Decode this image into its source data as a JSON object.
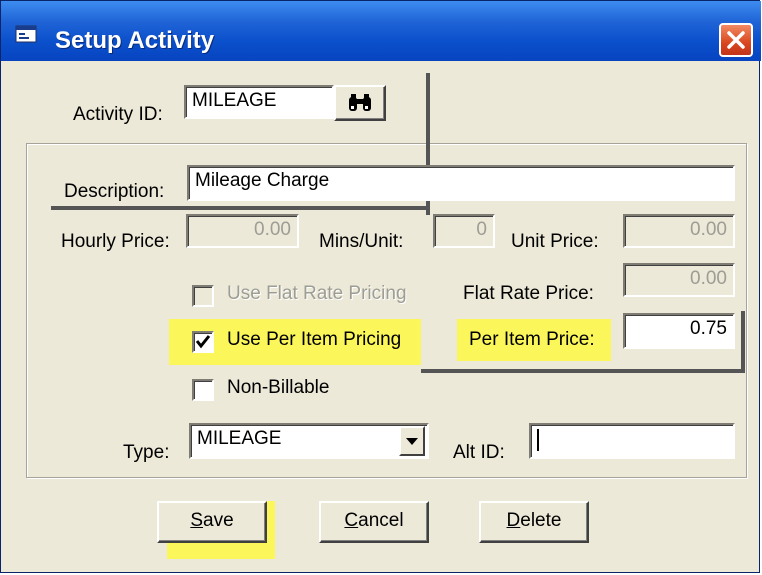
{
  "window": {
    "title": "Setup Activity"
  },
  "activity_id": {
    "label": "Activity ID:",
    "value": "MILEAGE"
  },
  "description": {
    "label": "Description:",
    "value": "Mileage Charge"
  },
  "hourly_price": {
    "label": "Hourly Price:",
    "value": "0.00"
  },
  "mins_unit": {
    "label": "Mins/Unit:",
    "value": "0"
  },
  "unit_price": {
    "label": "Unit Price:",
    "value": "0.00"
  },
  "flat_rate": {
    "checkbox_label": "Use Flat Rate Pricing",
    "checked": false,
    "price_label": "Flat Rate Price:",
    "price_value": "0.00"
  },
  "per_item": {
    "checkbox_label": "Use Per Item Pricing",
    "checked": true,
    "price_label": "Per Item Price:",
    "price_value": "0.75"
  },
  "non_billable": {
    "checkbox_label": "Non-Billable",
    "checked": false
  },
  "type": {
    "label": "Type:",
    "value": "MILEAGE"
  },
  "alt_id": {
    "label": "Alt ID:",
    "value": ""
  },
  "buttons": {
    "save": {
      "mnemonic": "S",
      "rest": "ave"
    },
    "cancel": {
      "mnemonic": "C",
      "rest": "ancel"
    },
    "delete": {
      "mnemonic": "D",
      "rest": "elete"
    }
  },
  "colors": {
    "highlight": "#fbf75a",
    "titlebar": "#0a4fcb",
    "face": "#ece9d8"
  }
}
